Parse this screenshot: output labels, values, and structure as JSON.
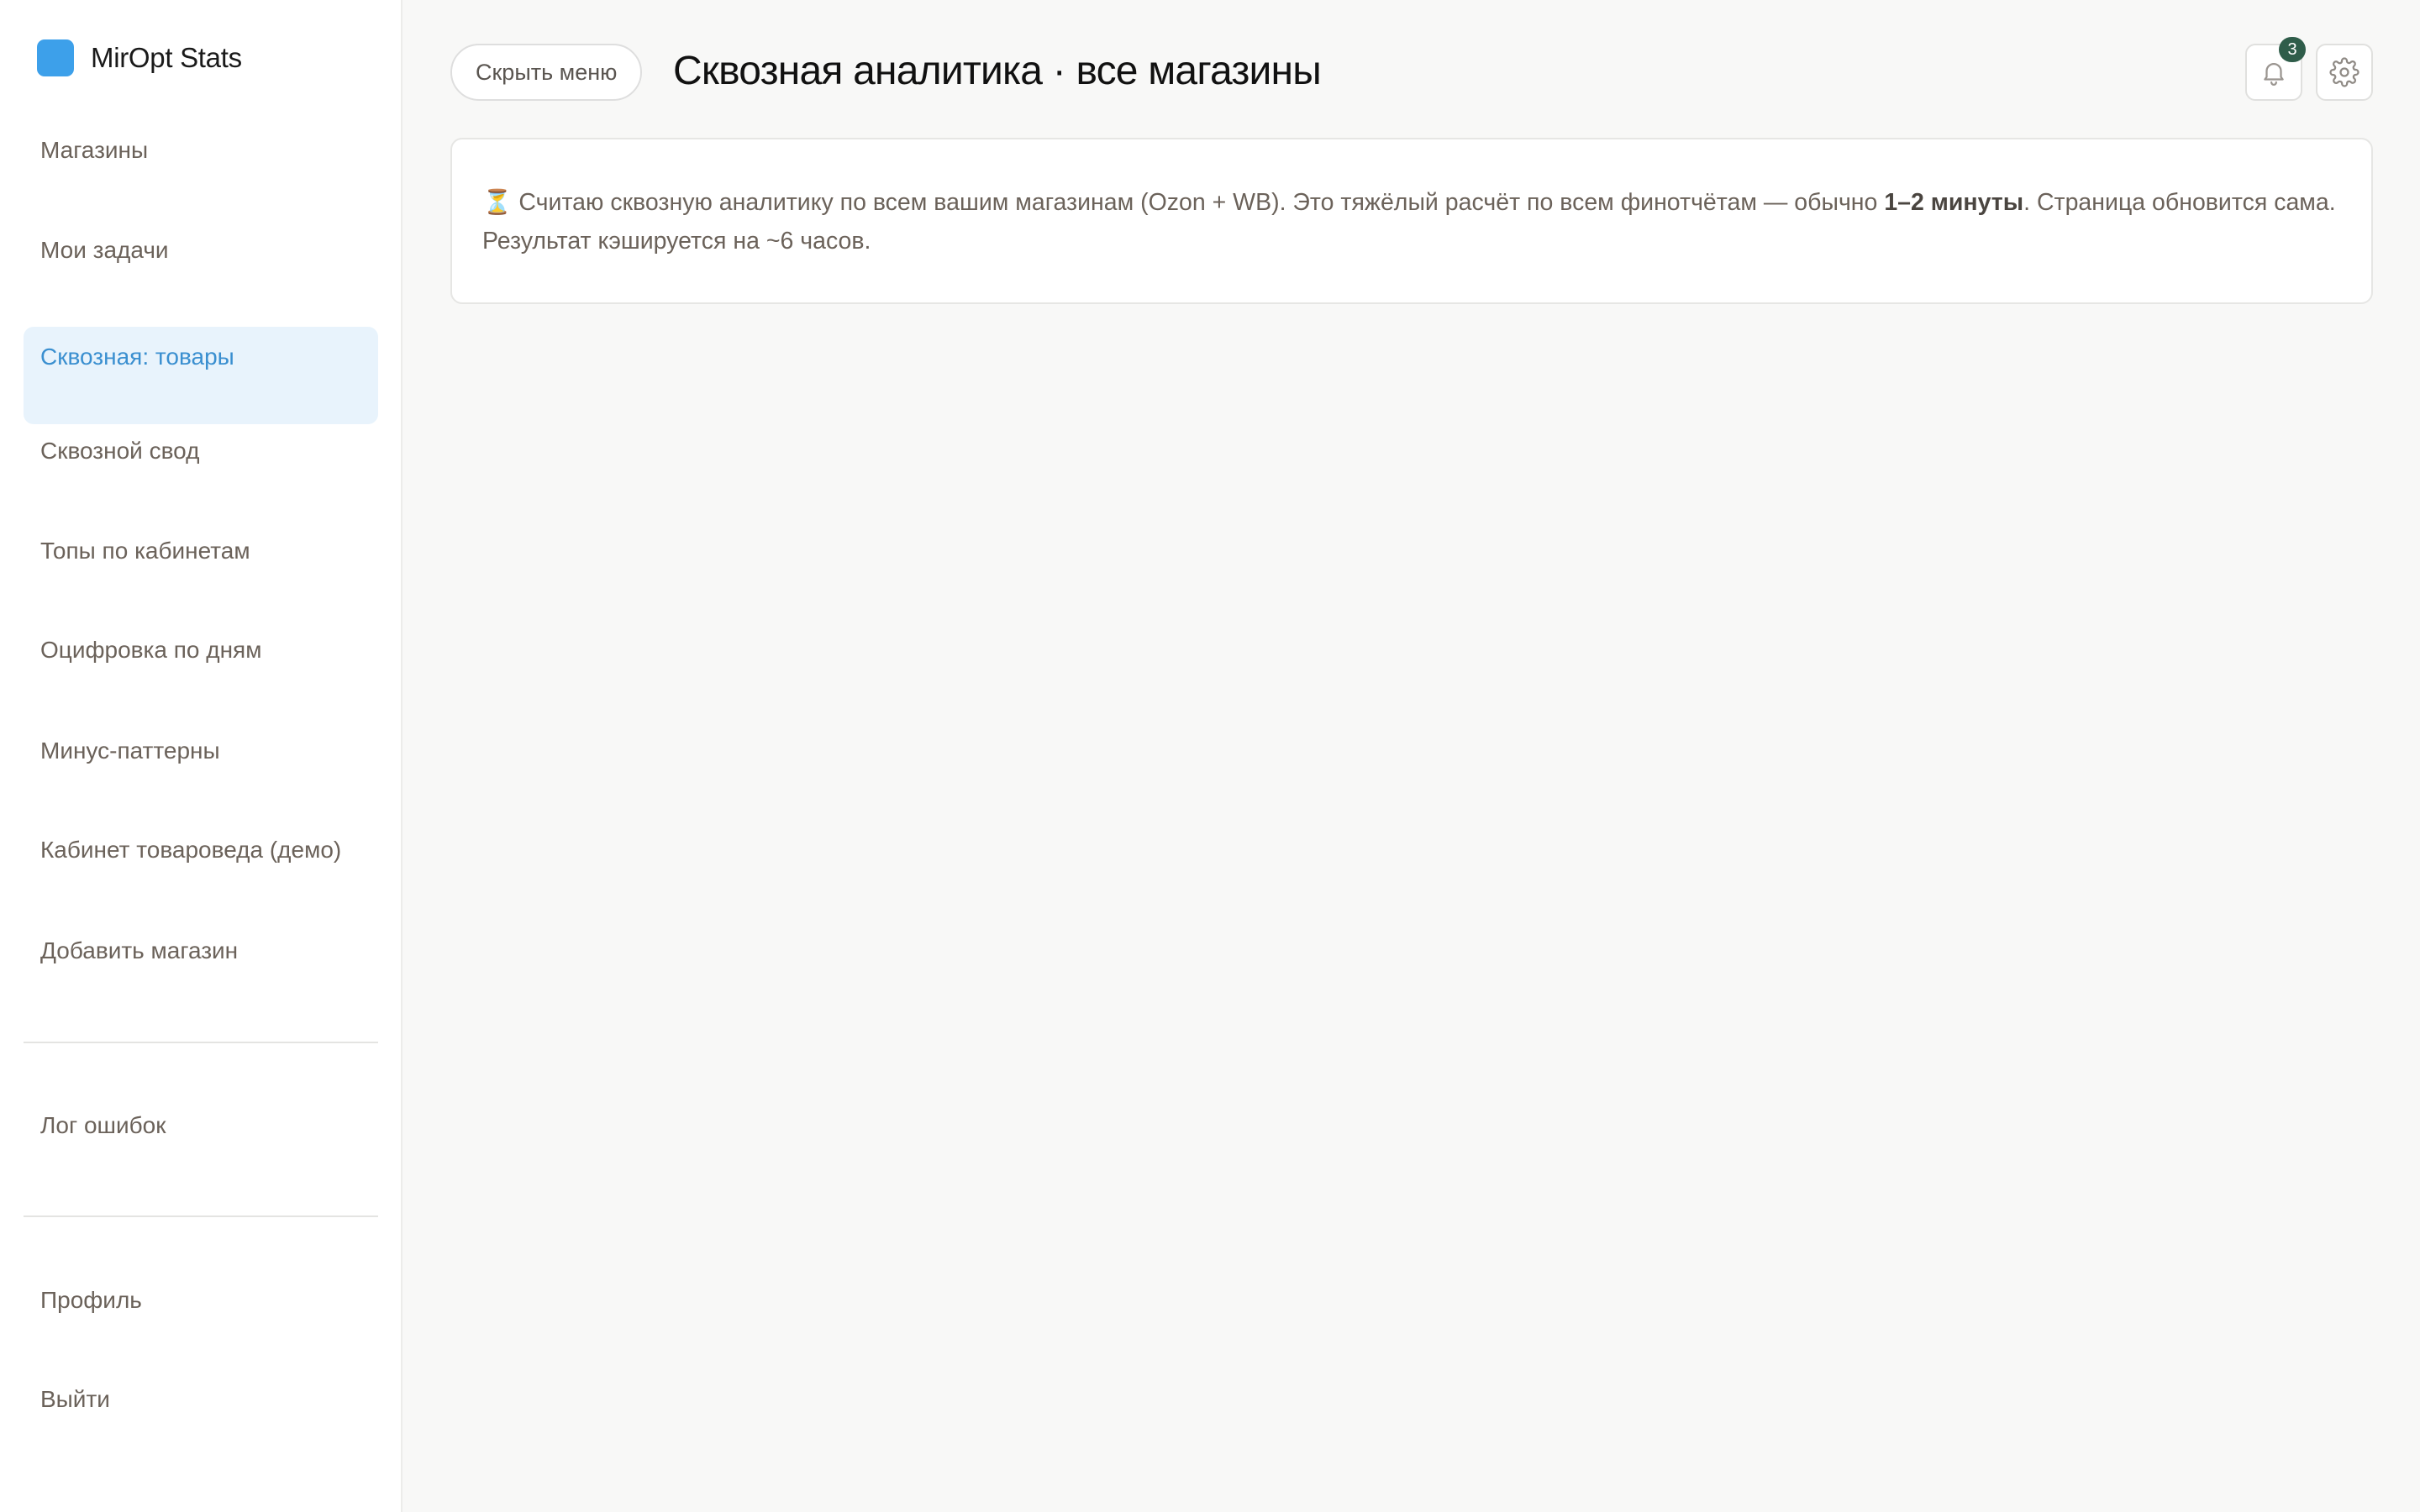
{
  "app": {
    "name": "MirOpt Stats",
    "brand_color": "#3da0ea"
  },
  "sidebar": {
    "items": [
      {
        "label": "Магазины"
      },
      {
        "label": "Мои задачи"
      },
      {
        "label": "Сквозная: товары",
        "active": true
      },
      {
        "label": "Сквозной свод"
      },
      {
        "label": "Топы по кабинетам"
      },
      {
        "label": "Оцифровка по дням"
      },
      {
        "label": "Минус-паттерны"
      },
      {
        "label": "Кабинет товароведа (демо)"
      },
      {
        "label": "Добавить магазин"
      }
    ],
    "secondary": [
      {
        "label": "Лог ошибок"
      }
    ],
    "footer": [
      {
        "label": "Профиль"
      },
      {
        "label": "Выйти"
      }
    ],
    "active_color": "#3a8fd0"
  },
  "header": {
    "toggle_menu_label": "Скрыть меню",
    "title": "Сквозная аналитика · все магазины",
    "notifications_count": "3",
    "bell_icon": "bell-icon",
    "settings_icon": "gear-icon"
  },
  "notice": {
    "icon": "⏳",
    "text_before": " Считаю сквозную аналитику по всем вашим магазинам (Ozon + WB). Это тяжёлый расчёт по всем финотчётам — обычно ",
    "text_bold": "1–2 минуты",
    "text_after": ". Страница обновится сама. Результат кэшируется на ~6 часов."
  }
}
